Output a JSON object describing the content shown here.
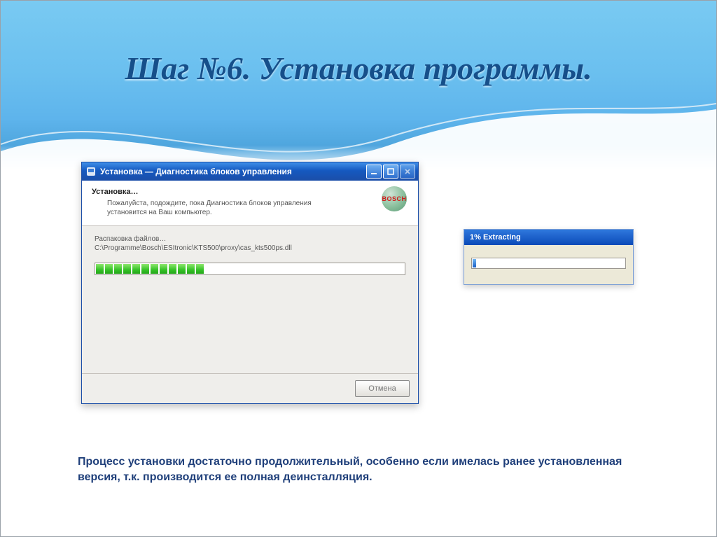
{
  "slide": {
    "title": "Шаг №6. Установка программы.",
    "description": "Процесс установки достаточно продолжительный, особенно если имелась ранее установленная версия, т.к. производится ее полная деинсталляция."
  },
  "installer": {
    "window_title": "Установка — Диагностика блоков управления",
    "brand": "BOSCH",
    "heading": "Установка…",
    "subheading": "Пожалуйста, подождите, пока Диагностика блоков управления установится на Ваш компьютер.",
    "status_line1": "Распаковка файлов…",
    "status_line2": "C:\\Programme\\Bosch\\ESItronic\\KTS500\\proxy\\cas_kts500ps.dll",
    "progress_segments": 12,
    "cancel_label": "Отмена"
  },
  "extract_panel": {
    "title": "1% Extracting",
    "progress_segments": 1
  }
}
